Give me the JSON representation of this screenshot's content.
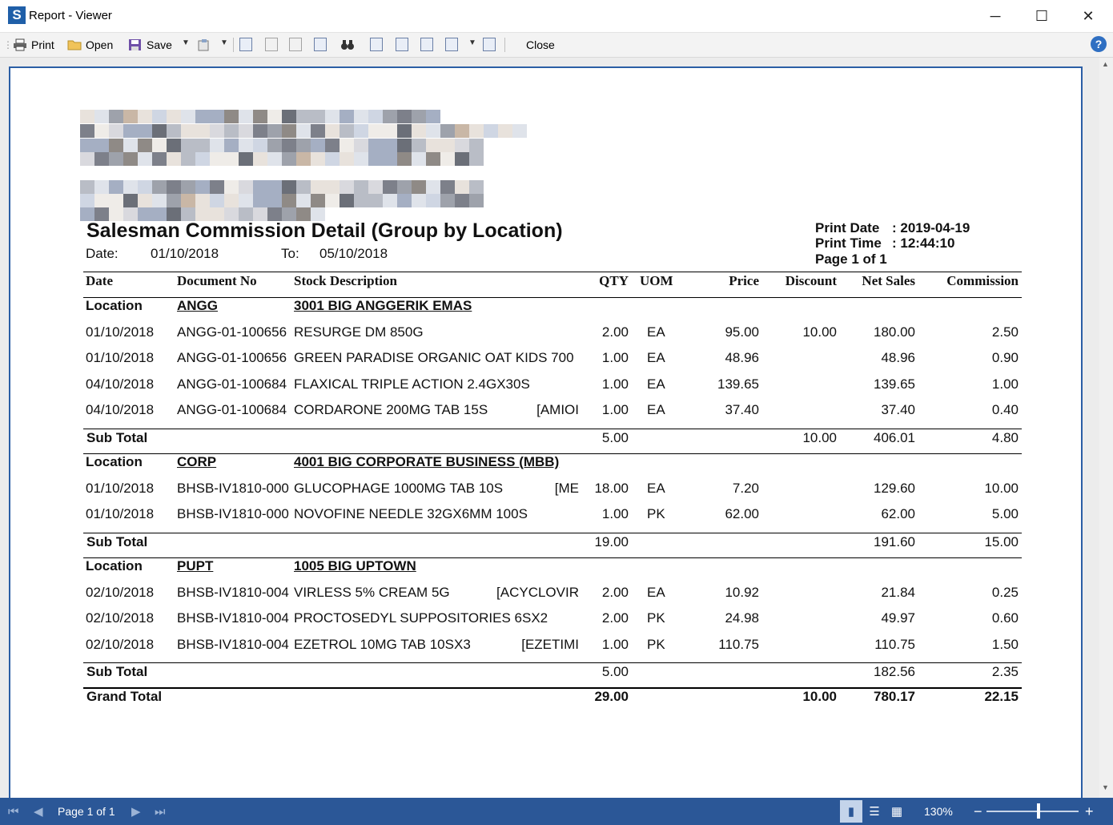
{
  "window": {
    "title": "Report - Viewer",
    "minimize": "─",
    "maximize": "☐",
    "close": "✕"
  },
  "toolbar": {
    "print": "Print",
    "open": "Open",
    "save": "Save",
    "close": "Close",
    "help": "?"
  },
  "report": {
    "title": "Salesman Commission Detail (Group by Location)",
    "date_label": "Date:",
    "date_from": "01/10/2018",
    "to_label": "To:",
    "date_to": "05/10/2018",
    "print_date_label": "Print Date",
    "print_date": ": 2019-04-19",
    "print_time_label": "Print Time",
    "print_time": ": 12:44:10",
    "page_info": "Page 1 of 1",
    "columns": {
      "date": "Date",
      "document_no": "Document No",
      "stock_description": "Stock Description",
      "qty": "QTY",
      "uom": "UOM",
      "price": "Price",
      "discount": "Discount",
      "net_sales": "Net Sales",
      "commission": "Commission"
    },
    "location_label": "Location",
    "subtotal_label": "Sub Total",
    "grand_total_label": "Grand Total",
    "groups": [
      {
        "code": "ANGG",
        "name": "3001 BIG ANGGERIK EMAS",
        "rows": [
          {
            "date": "01/10/2018",
            "doc": "ANGG-01-100656",
            "desc": "RESURGE DM 850G",
            "desc_extra": "",
            "qty": "2.00",
            "uom": "EA",
            "price": "95.00",
            "discount": "10.00",
            "net": "180.00",
            "comm": "2.50"
          },
          {
            "date": "01/10/2018",
            "doc": "ANGG-01-100656",
            "desc": "GREEN PARADISE ORGANIC OAT KIDS 700",
            "desc_extra": "",
            "qty": "1.00",
            "uom": "EA",
            "price": "48.96",
            "discount": "",
            "net": "48.96",
            "comm": "0.90"
          },
          {
            "date": "04/10/2018",
            "doc": "ANGG-01-100684",
            "desc": "FLAXICAL TRIPLE ACTION 2.4GX30S",
            "desc_extra": "",
            "qty": "1.00",
            "uom": "EA",
            "price": "139.65",
            "discount": "",
            "net": "139.65",
            "comm": "1.00"
          },
          {
            "date": "04/10/2018",
            "doc": "ANGG-01-100684",
            "desc": "CORDARONE 200MG TAB 15S",
            "desc_extra": "[AMIOI",
            "qty": "1.00",
            "uom": "EA",
            "price": "37.40",
            "discount": "",
            "net": "37.40",
            "comm": "0.40"
          }
        ],
        "subtotal": {
          "qty": "5.00",
          "discount": "10.00",
          "net": "406.01",
          "comm": "4.80"
        }
      },
      {
        "code": "CORP",
        "name": "4001 BIG CORPORATE BUSINESS (MBB)",
        "rows": [
          {
            "date": "01/10/2018",
            "doc": "BHSB-IV1810-000",
            "desc": "GLUCOPHAGE 1000MG TAB 10S",
            "desc_extra": "[ME",
            "qty": "18.00",
            "uom": "EA",
            "price": "7.20",
            "discount": "",
            "net": "129.60",
            "comm": "10.00"
          },
          {
            "date": "01/10/2018",
            "doc": "BHSB-IV1810-000",
            "desc": "NOVOFINE NEEDLE 32GX6MM 100S",
            "desc_extra": "",
            "qty": "1.00",
            "uom": "PK",
            "price": "62.00",
            "discount": "",
            "net": "62.00",
            "comm": "5.00"
          }
        ],
        "subtotal": {
          "qty": "19.00",
          "discount": "",
          "net": "191.60",
          "comm": "15.00"
        }
      },
      {
        "code": "PUPT",
        "name": "1005 BIG UPTOWN",
        "rows": [
          {
            "date": "02/10/2018",
            "doc": "BHSB-IV1810-004",
            "desc": "VIRLESS 5% CREAM 5G",
            "desc_extra": "[ACYCLOVIR",
            "qty": "2.00",
            "uom": "EA",
            "price": "10.92",
            "discount": "",
            "net": "21.84",
            "comm": "0.25"
          },
          {
            "date": "02/10/2018",
            "doc": "BHSB-IV1810-004",
            "desc": "PROCTOSEDYL SUPPOSITORIES 6SX2",
            "desc_extra": "",
            "qty": "2.00",
            "uom": "PK",
            "price": "24.98",
            "discount": "",
            "net": "49.97",
            "comm": "0.60"
          },
          {
            "date": "02/10/2018",
            "doc": "BHSB-IV1810-004",
            "desc": "EZETROL 10MG TAB 10SX3",
            "desc_extra": "[EZETIMI",
            "qty": "1.00",
            "uom": "PK",
            "price": "110.75",
            "discount": "",
            "net": "110.75",
            "comm": "1.50"
          }
        ],
        "subtotal": {
          "qty": "5.00",
          "discount": "",
          "net": "182.56",
          "comm": "2.35"
        }
      }
    ],
    "grand_total": {
      "qty": "29.00",
      "discount": "10.00",
      "net": "780.17",
      "comm": "22.15"
    }
  },
  "status": {
    "page": "Page 1 of 1",
    "zoom": "130%",
    "zoom_level_percent": 130,
    "minus": "−",
    "plus": "+"
  },
  "colors": {
    "accent": "#2b5797",
    "page_border": "#2b5ea5"
  }
}
